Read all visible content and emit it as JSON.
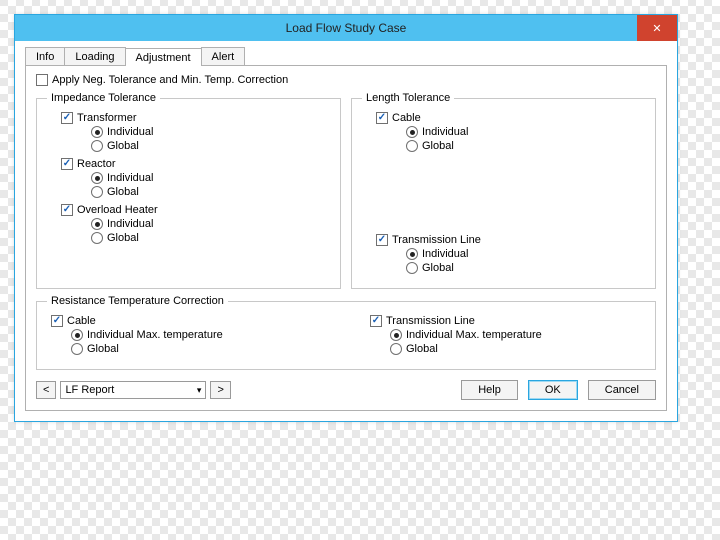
{
  "window": {
    "title": "Load Flow Study Case"
  },
  "tabs": [
    "Info",
    "Loading",
    "Adjustment",
    "Alert"
  ],
  "active_tab": 2,
  "apply_neg": {
    "label": "Apply Neg. Tolerance and Min. Temp. Correction",
    "checked": false
  },
  "impedance": {
    "legend": "Impedance Tolerance",
    "items": [
      {
        "label": "Transformer",
        "checked": true,
        "mode": "individual"
      },
      {
        "label": "Reactor",
        "checked": true,
        "mode": "individual"
      },
      {
        "label": "Overload Heater",
        "checked": true,
        "mode": "individual"
      }
    ]
  },
  "length": {
    "legend": "Length Tolerance",
    "items": [
      {
        "label": "Cable",
        "checked": true,
        "mode": "individual"
      },
      {
        "label": "Transmission Line",
        "checked": true,
        "mode": "individual"
      }
    ]
  },
  "resistance": {
    "legend": "Resistance Temperature Correction",
    "items": [
      {
        "label": "Cable",
        "checked": true,
        "mode": "individual"
      },
      {
        "label": "Transmission Line",
        "checked": true,
        "mode": "individual"
      }
    ]
  },
  "radios": {
    "individual": "Individual",
    "global": "Global",
    "individual_max": "Individual Max. temperature"
  },
  "footer": {
    "prev": "<",
    "next": ">",
    "report_select": "LF Report",
    "help": "Help",
    "ok": "OK",
    "cancel": "Cancel"
  }
}
